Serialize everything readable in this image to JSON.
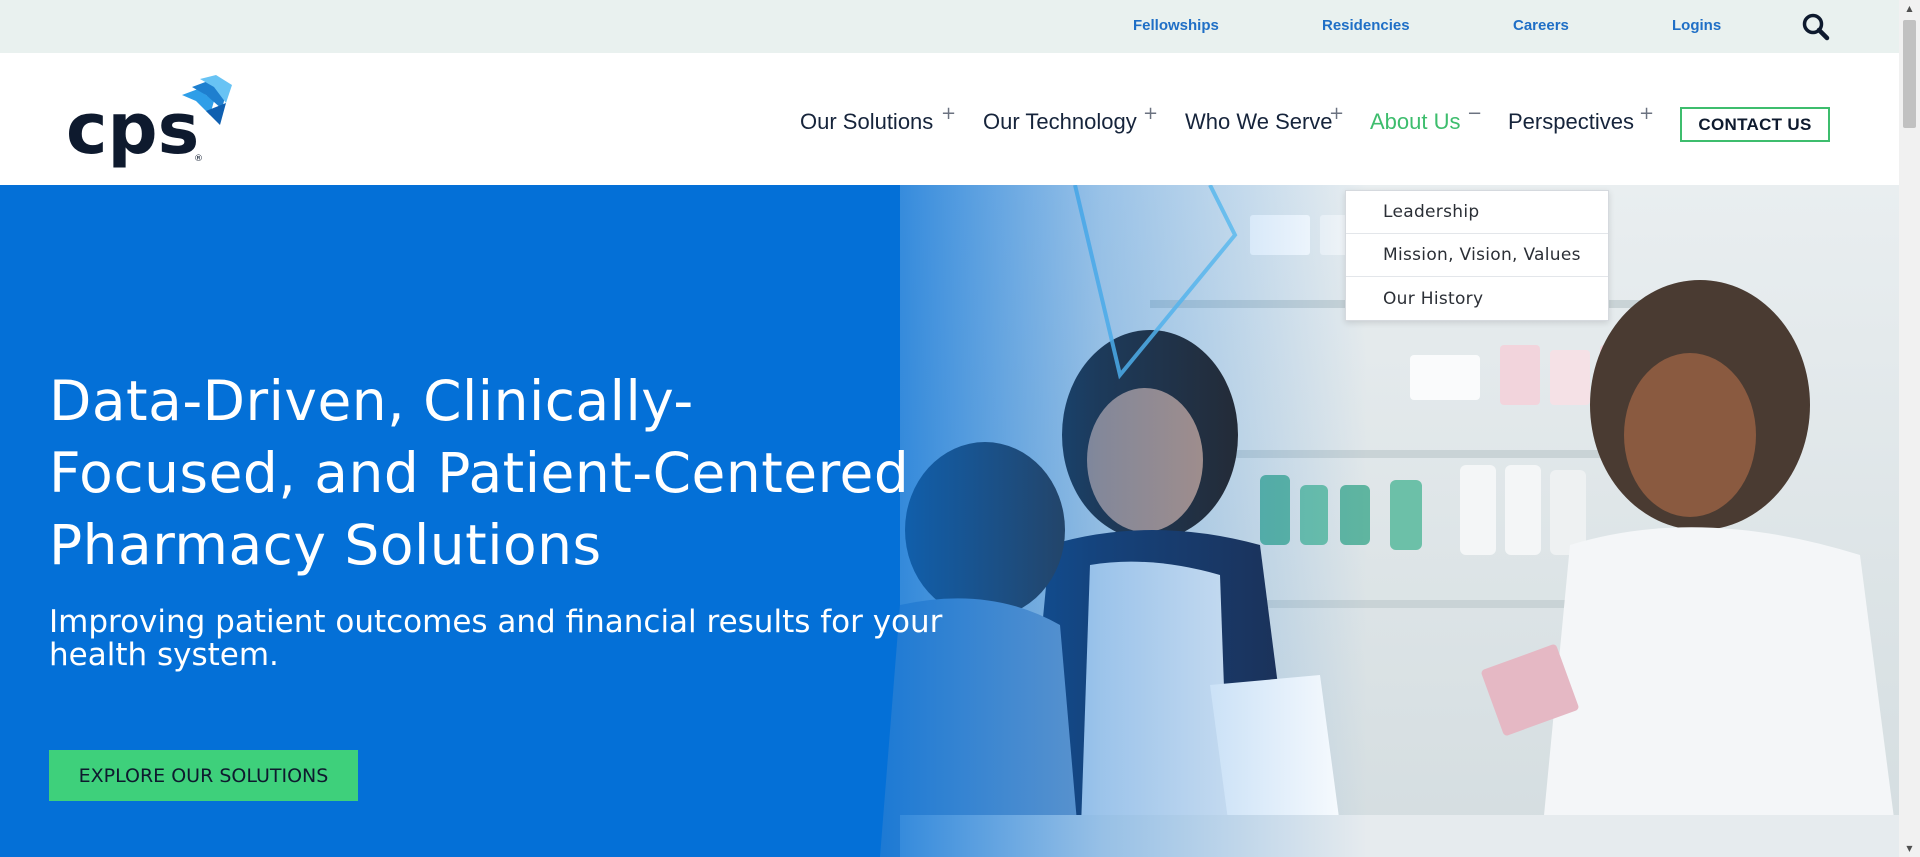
{
  "utility_nav": {
    "links": [
      "Fellowships",
      "Residencies",
      "Careers",
      "Logins"
    ],
    "search_icon": "search-icon"
  },
  "header": {
    "logo_text": "cps",
    "logo_mark": "®",
    "nav": [
      {
        "label": "Our Solutions",
        "toggle": "+"
      },
      {
        "label": "Our Technology",
        "toggle": "+"
      },
      {
        "label": "Who We Serve",
        "toggle": "+"
      },
      {
        "label": "About Us",
        "toggle": "−"
      },
      {
        "label": "Perspectives",
        "toggle": "+"
      }
    ],
    "contact_label": "CONTACT US"
  },
  "dropdown": {
    "items": [
      "Leadership",
      "Mission, Vision, Values",
      "Our History"
    ]
  },
  "hero": {
    "heading_lines": [
      "Data-Driven, Clinically-",
      "Focused, and Patient-Centered",
      "Pharmacy Solutions"
    ],
    "subheading": "Improving patient outcomes and financial results for your health system.",
    "cta_label": "EXPLORE OUR SOLUTIONS"
  },
  "colors": {
    "hero_blue": "#0470d7",
    "accent_green": "#3dbd6d",
    "link_blue": "#1f6fc6",
    "navy": "#16243b",
    "utility_bg": "#e9f1ef"
  }
}
